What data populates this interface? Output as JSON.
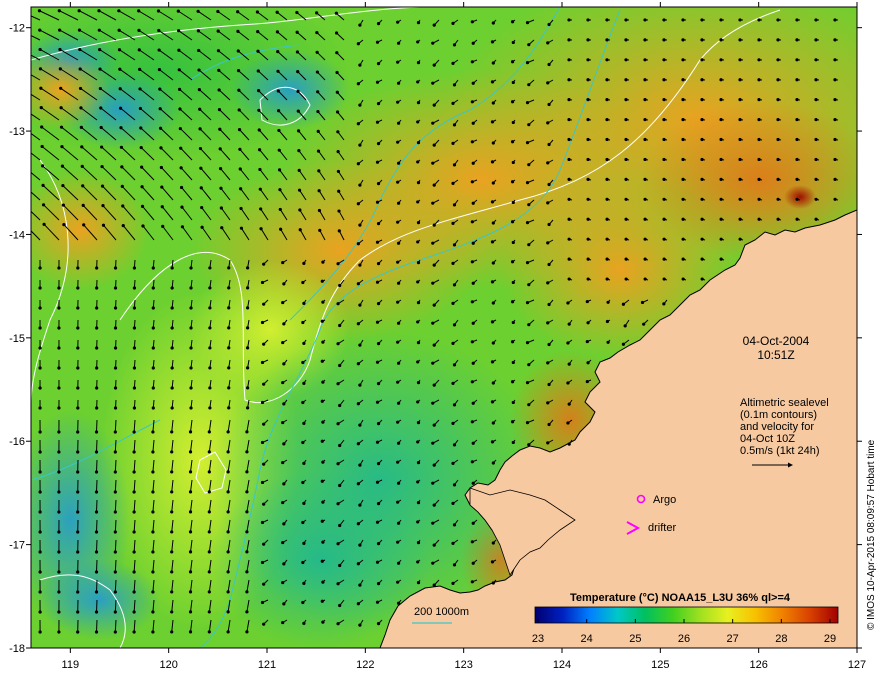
{
  "map": {
    "lon_range": [
      118.6,
      127
    ],
    "lat_range": [
      -18,
      -11.8
    ],
    "x_ticks": [
      "119",
      "120",
      "121",
      "122",
      "123",
      "124",
      "125",
      "126",
      "127"
    ],
    "y_ticks": [
      "-12",
      "-13",
      "-14",
      "-15",
      "-16",
      "-17",
      "-18"
    ],
    "land_color": "#f7c9a0",
    "coast_color": "#000000",
    "contour_color": "#ffffff",
    "isobath_color": "#3cc6c6"
  },
  "annotation": {
    "date": "04-Oct-2004",
    "time": "10:51Z",
    "desc_lines": [
      "Altimetric sealevel",
      "(0.1m contours)",
      "and velocity for",
      "04-Oct 10Z",
      "0.5m/s (1kt 24h)"
    ]
  },
  "markers": {
    "argo_label": "Argo",
    "argo_symbol": "o",
    "drifter_label": "drifter",
    "drifter_symbol": ">",
    "marker_color": "#ff00ff"
  },
  "isobath_legend": {
    "label": "200  1000m"
  },
  "colorbar": {
    "title": "Temperature (°C) NOAA15_L3U 36% ql>=4",
    "ticks": [
      "23",
      "24",
      "25",
      "26",
      "27",
      "28",
      "29"
    ],
    "colors": [
      "#000070",
      "#0020c0",
      "#0080ff",
      "#00c8c8",
      "#00c060",
      "#40d020",
      "#a0e020",
      "#e8f020",
      "#f8c000",
      "#f08000",
      "#d84000",
      "#a00000"
    ]
  },
  "credit": "© IMOS 10-Apr-2015 08:09:57 Hobart time"
}
